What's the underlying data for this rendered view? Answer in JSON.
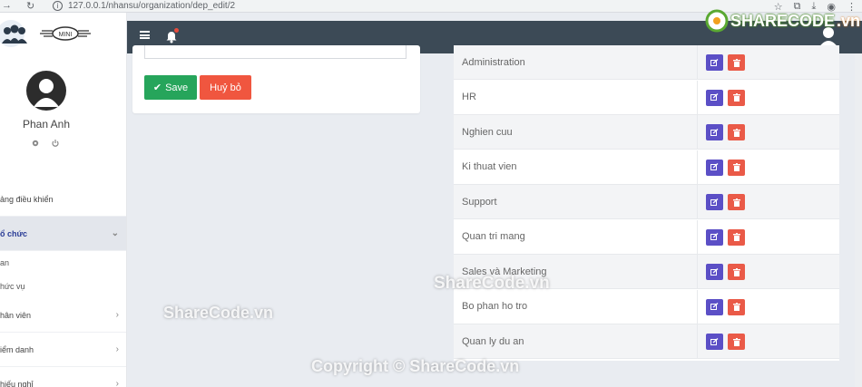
{
  "browser": {
    "url": "127.0.0.1/nhansu/organization/dep_edit/2"
  },
  "user": {
    "name": "Phan Anh"
  },
  "sidebar": {
    "dashboard": "ảng điều khiển",
    "org": "ổ chức",
    "sub1": "an",
    "sub2": "hức vụ",
    "staff": "hân viên",
    "attendance": "iểm danh",
    "leave": "hiếu nghỉ"
  },
  "form": {
    "save_label": "Save",
    "cancel_label": "Huỷ bỏ"
  },
  "departments": [
    {
      "name": "Administration"
    },
    {
      "name": "HR"
    },
    {
      "name": "Nghien cuu"
    },
    {
      "name": "Ki thuat vien"
    },
    {
      "name": "Support"
    },
    {
      "name": "Quan tri mang"
    },
    {
      "name": "Sales và Marketing"
    },
    {
      "name": "Bo phan ho tro"
    },
    {
      "name": "Quan ly du an"
    }
  ],
  "watermarks": {
    "w1": "ShareCode.vn",
    "w2": "ShareCode.vn",
    "w3": "Copyright © ShareCode.vn",
    "brand_share": "SHARECODE",
    "brand_vn": ".vn"
  },
  "colors": {
    "topbar": "#3c4a56",
    "save": "#26a55b",
    "cancel": "#f0563f",
    "edit": "#5b4fc6",
    "delete": "#ea5a48"
  }
}
